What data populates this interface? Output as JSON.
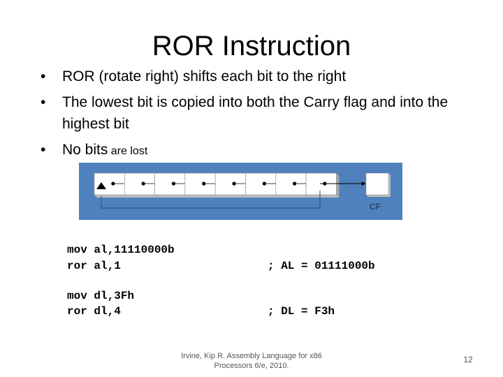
{
  "slide": {
    "title": "ROR Instruction",
    "bullets": [
      {
        "text": "ROR (rotate right) shifts each bit to the right",
        "small_suffix": ""
      },
      {
        "text": "The lowest bit is copied into both the Carry flag and into the highest bit",
        "small_suffix": ""
      },
      {
        "text": "No bits",
        "small_suffix": " are lost"
      }
    ],
    "bullet_glyph": "•",
    "diagram": {
      "background_color": "#4f81bd",
      "bit_count": 8,
      "carry_label": "CF"
    },
    "code_blocks": [
      {
        "lines": [
          "mov al,11110000b",
          "ror al,1"
        ],
        "comment": "; AL = 01111000b"
      },
      {
        "lines": [
          "mov dl,3Fh",
          "ror dl,4"
        ],
        "comment": "; DL = F3h"
      }
    ],
    "footer": {
      "citation_line1": "Irvine, Kip R. Assembly Language for x86",
      "citation_line2": "Processors 6/e, 2010.",
      "page_number": "12"
    }
  }
}
